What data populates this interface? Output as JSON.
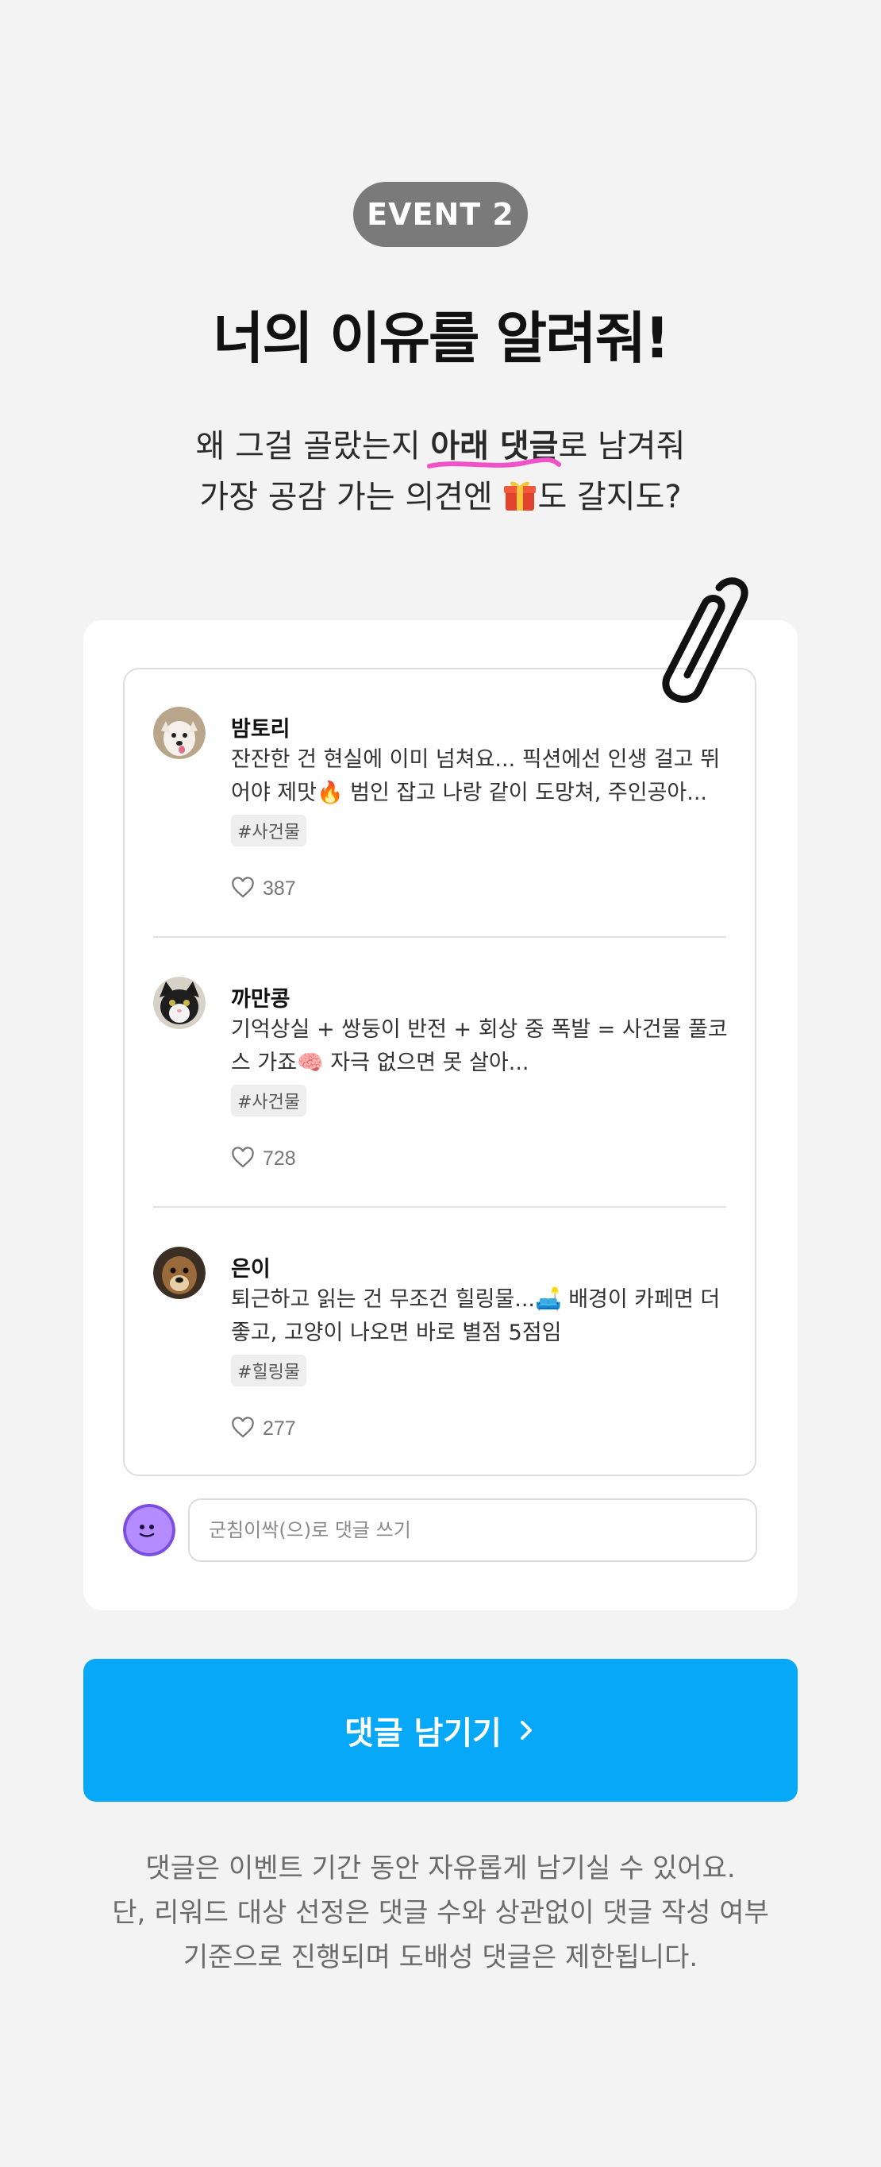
{
  "event_badge": "EVENT 2",
  "title": "너의 이유를 알려줘!",
  "subtitle": {
    "line1_pre": "왜 그걸 골랐는지 ",
    "line1_highlight": "아래 댓글",
    "line1_post": "로 남겨줘",
    "line2_pre": "가장 공감 가는 의견엔 ",
    "line2_post": "도 갈지도?"
  },
  "comments": [
    {
      "name": "밤토리",
      "text": "잔잔한 건 현실에 이미 넘쳐요... 픽션에선 인생 걸고 뛰어야 제맛🔥 범인 잡고 나랑 같이 도망쳐, 주인공아...",
      "tag": "#사건물",
      "likes": "387"
    },
    {
      "name": "까만콩",
      "text": "기억상실 + 쌍둥이 반전 + 회상 중 폭발 = 사건물 풀코스 가죠🧠 자극 없으면 못 살아...",
      "tag": "#사건물",
      "likes": "728"
    },
    {
      "name": "은이",
      "text": "퇴근하고 읽는 건 무조건 힐링물...🛋️ 배경이 카페면 더 좋고, 고양이 나오면 바로 별점 5점임",
      "tag": "#힐링물",
      "likes": "277"
    }
  ],
  "comment_input": {
    "placeholder": "군침이싹(으)로 댓글 쓰기"
  },
  "cta": {
    "label": "댓글 남기기",
    "icon": "chevron-right-icon"
  },
  "notice": {
    "line1": "댓글은 이벤트 기간 동안 자유롭게 남기실 수 있어요.",
    "line2": "단, 리워드 대상 선정은 댓글 수와 상관없이 댓글 작성 여부",
    "line3": "기준으로 진행되며 도배성 댓글은 제한됩니다."
  },
  "colors": {
    "accent": "#06a8f7",
    "highlight": "#f052c8",
    "badge": "#7a7a7a"
  }
}
